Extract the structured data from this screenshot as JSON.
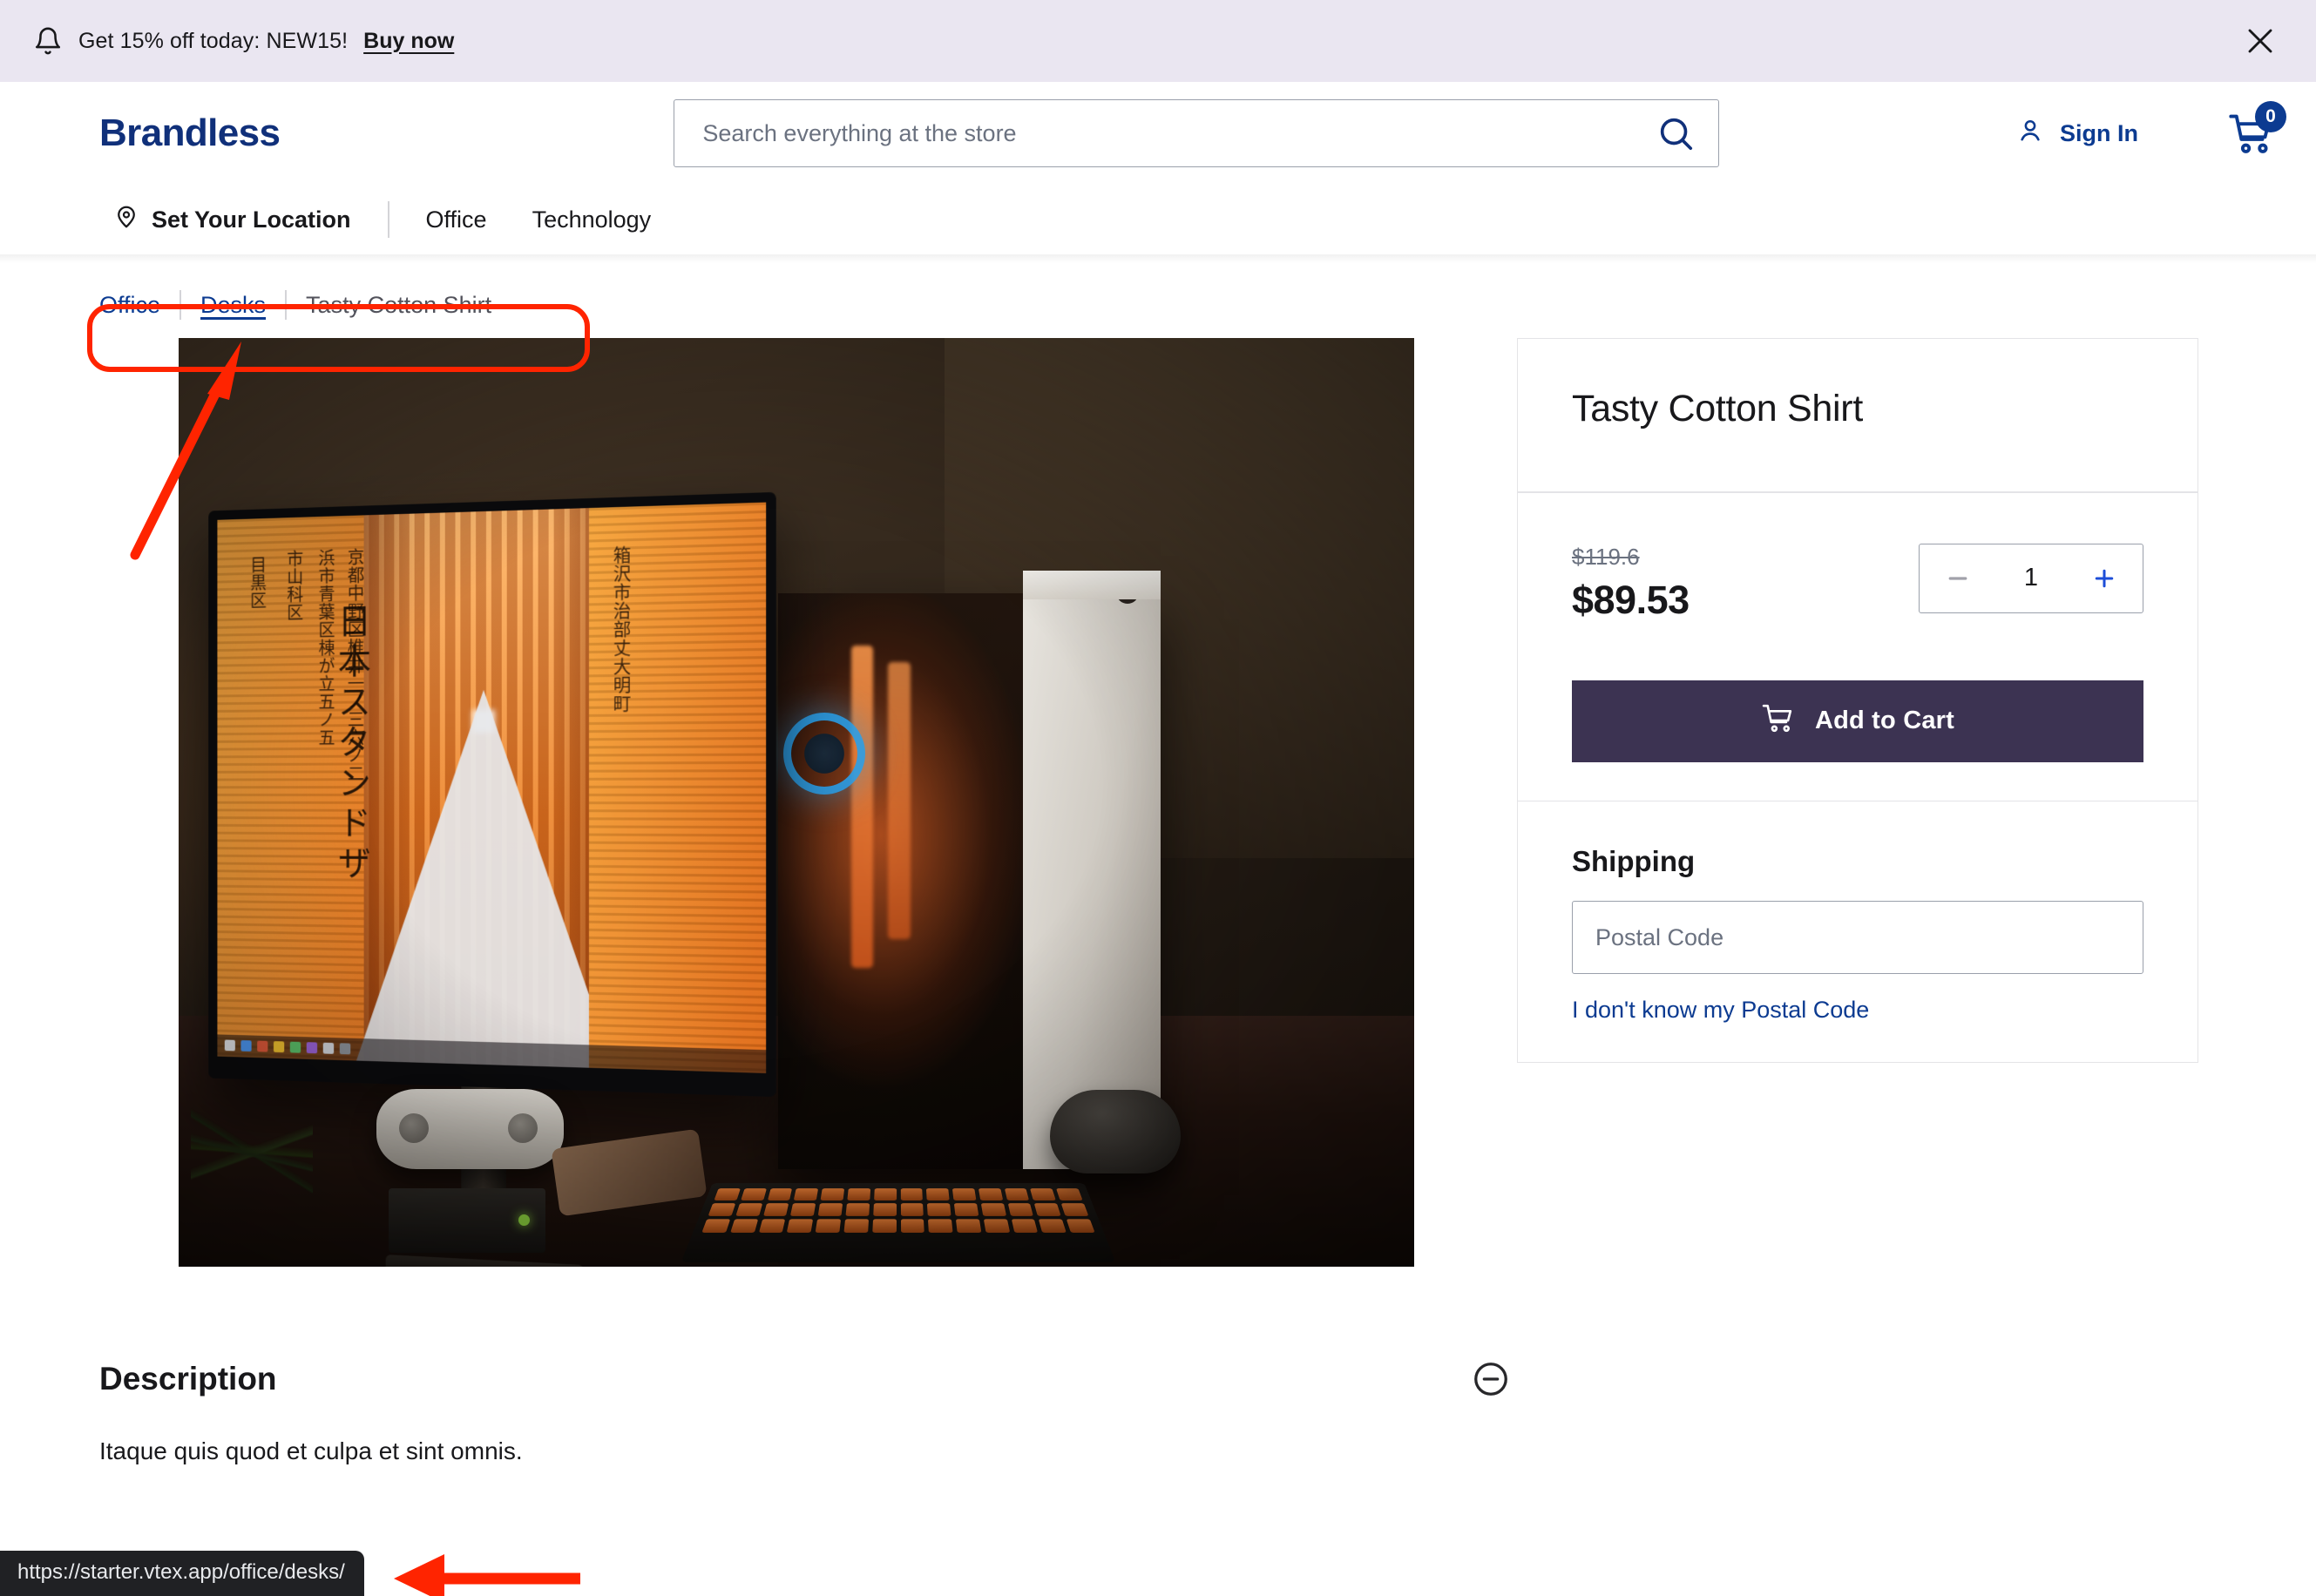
{
  "announcement": {
    "icon": "bell-icon",
    "text": "Get 15% off today: NEW15!",
    "cta": "Buy now",
    "close_icon": "close-icon",
    "background": "#eae6f1"
  },
  "header": {
    "logo": "Brandless",
    "logo_color": "#10307a",
    "search": {
      "placeholder": "Search everything at the store",
      "value": "",
      "icon": "search-icon"
    },
    "account": {
      "icon": "user-icon",
      "label": "Sign In"
    },
    "cart": {
      "icon": "cart-icon",
      "count": "0",
      "badge_color": "#0c3b91"
    }
  },
  "nav": {
    "location": {
      "icon": "location-pin-icon",
      "label": "Set Your Location"
    },
    "links": [
      "Office",
      "Technology"
    ]
  },
  "breadcrumb": {
    "items": [
      {
        "label": "Office",
        "state": "link"
      },
      {
        "label": "Desks",
        "state": "link-hover"
      },
      {
        "label": "Tasty Cotton Shirt",
        "state": "current"
      }
    ]
  },
  "gallery": {
    "alt": "Dark desk setup with monitor showing orange torii gate corridor",
    "screen_text_big": "日本スタンドザ",
    "screen_text_cols": [
      "目黒区",
      "市山科区",
      "浜市青葉区棟が立五ノ五",
      "京都中野区椎井一ノ三六ノ二",
      "箱沢市治部丈大明町"
    ]
  },
  "buybox": {
    "title": "Tasty Cotton Shirt",
    "price_old": "$119.6",
    "price_new": "$89.53",
    "quantity": {
      "value": "1",
      "decrement_icon": "minus-icon",
      "increment_icon": "plus-icon",
      "decrement_disabled": true
    },
    "add_to_cart": {
      "label": "Add to Cart",
      "icon": "cart-icon",
      "color": "#3c3352"
    },
    "shipping": {
      "title": "Shipping",
      "postal_placeholder": "Postal Code",
      "postal_value": "",
      "help_link": "I don't know my Postal Code"
    }
  },
  "description": {
    "title": "Description",
    "toggle_icon": "circle-minus-icon",
    "body": "Itaque quis quod et culpa et sint omnis."
  },
  "status_bar": {
    "url": "https://starter.vtex.app/office/desks/"
  },
  "annotations": {
    "highlight_color": "#ff2400",
    "box_target": "breadcrumb",
    "arrow_to_breadcrumb": true,
    "arrow_to_status_url": true
  }
}
